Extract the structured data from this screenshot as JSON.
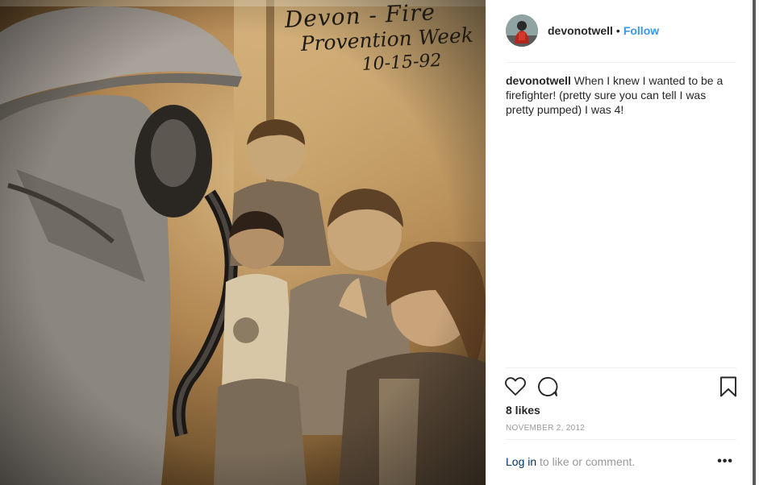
{
  "photo": {
    "handwriting_line1": "Devon - Fire",
    "handwriting_line2": "Provention Week",
    "handwriting_line3": "10-15-92"
  },
  "header": {
    "username": "devonotwell",
    "separator": "•",
    "follow_label": "Follow"
  },
  "caption": {
    "username": "devonotwell",
    "text": "When I knew I wanted to be a firefighter! (pretty sure you can tell I was pretty pumped) I was 4!"
  },
  "actions": {
    "like_icon": "heart-icon",
    "comment_icon": "comment-icon",
    "save_icon": "bookmark-icon"
  },
  "likes": "8 likes",
  "date": "NOVEMBER 2, 2012",
  "footer": {
    "login_label": "Log in",
    "login_suffix": " to like or comment.",
    "more_label": "•••"
  },
  "colors": {
    "link_blue": "#3897f0",
    "login_link": "#003569",
    "muted_text": "#999999",
    "text": "#262626"
  }
}
